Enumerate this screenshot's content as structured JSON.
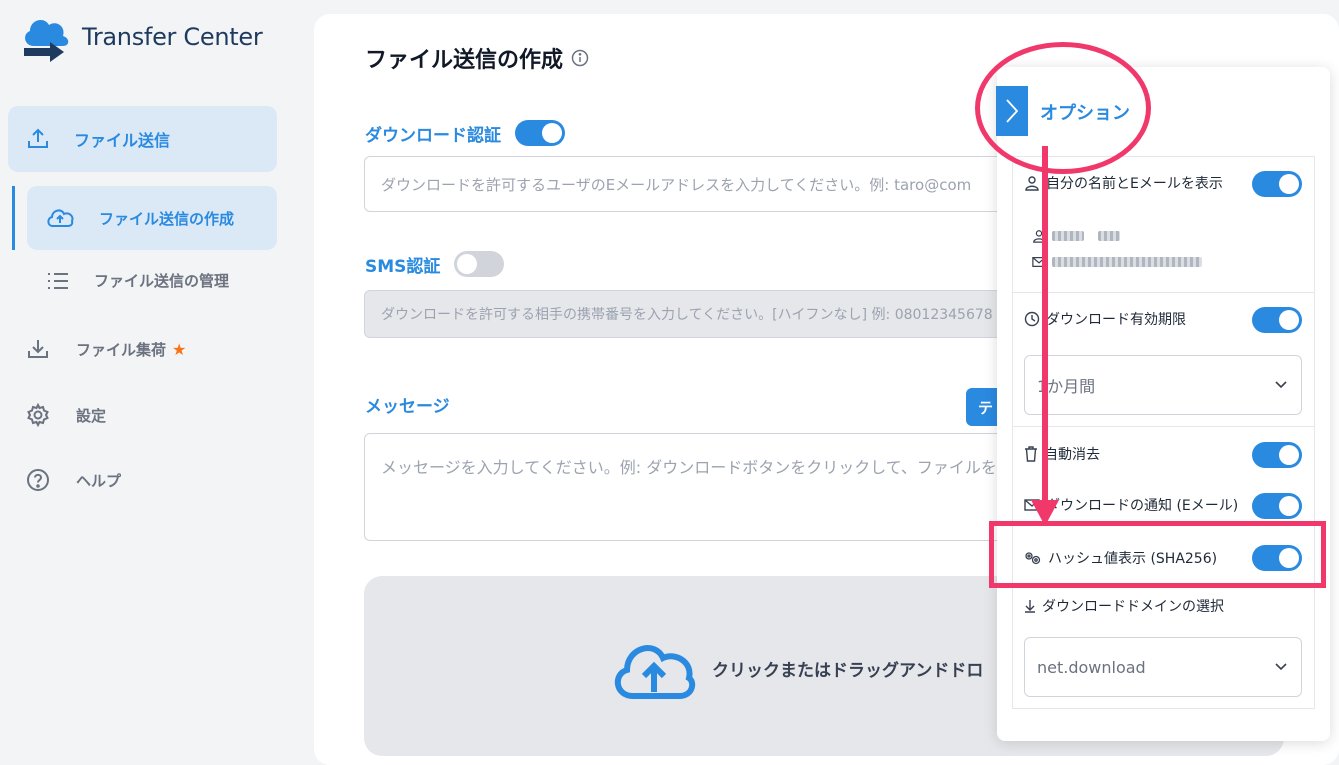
{
  "app": {
    "logo_text": "Transfer Center"
  },
  "sidebar": {
    "send": "ファイル送信",
    "create": "ファイル送信の作成",
    "manage": "ファイル送信の管理",
    "collect": "ファイル集荷",
    "settings": "設定",
    "help": "ヘルプ"
  },
  "main": {
    "title": "ファイル送信の作成",
    "download_auth_label": "ダウンロード認証",
    "download_auth_placeholder": "ダウンロードを許可するユーザのEメールアドレスを入力してください。例: taro@com",
    "sms_auth_label": "SMS認証",
    "sms_placeholder": "ダウンロードを許可する相手の携帯番号を入力してください。[ハイフンなし] 例: 08012345678",
    "message_label": "メッセージ",
    "template_button": "テ",
    "message_placeholder": "メッセージを入力してください。例: ダウンロードボタンをクリックして、ファイルを保",
    "drop_text": "クリックまたはドラッグアンドドロ"
  },
  "options": {
    "title": "オプション",
    "show_name_email": "自分の名前とEメールを表示",
    "download_expiry": "ダウンロード有効期限",
    "expiry_value": "1か月間",
    "auto_delete": "自動消去",
    "download_notify": "ダウンロードの通知 (Eメール)",
    "hash_display": "ハッシュ値表示 (SHA256)",
    "download_domain": "ダウンロードドメインの選択",
    "domain_value": "net.download"
  },
  "colors": {
    "accent": "#2a8ae0",
    "annotation": "#f0386b"
  }
}
